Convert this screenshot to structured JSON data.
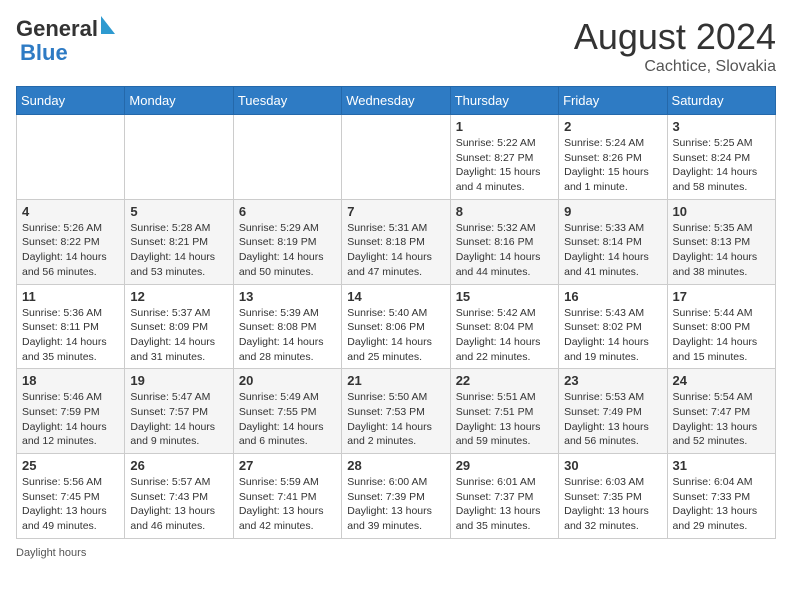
{
  "header": {
    "logo_general": "General",
    "logo_blue": "Blue",
    "month_year": "August 2024",
    "location": "Cachtice, Slovakia"
  },
  "days_of_week": [
    "Sunday",
    "Monday",
    "Tuesday",
    "Wednesday",
    "Thursday",
    "Friday",
    "Saturday"
  ],
  "weeks": [
    [
      {
        "day": "",
        "info": ""
      },
      {
        "day": "",
        "info": ""
      },
      {
        "day": "",
        "info": ""
      },
      {
        "day": "",
        "info": ""
      },
      {
        "day": "1",
        "info": "Sunrise: 5:22 AM\nSunset: 8:27 PM\nDaylight: 15 hours and 4 minutes."
      },
      {
        "day": "2",
        "info": "Sunrise: 5:24 AM\nSunset: 8:26 PM\nDaylight: 15 hours and 1 minute."
      },
      {
        "day": "3",
        "info": "Sunrise: 5:25 AM\nSunset: 8:24 PM\nDaylight: 14 hours and 58 minutes."
      }
    ],
    [
      {
        "day": "4",
        "info": "Sunrise: 5:26 AM\nSunset: 8:22 PM\nDaylight: 14 hours and 56 minutes."
      },
      {
        "day": "5",
        "info": "Sunrise: 5:28 AM\nSunset: 8:21 PM\nDaylight: 14 hours and 53 minutes."
      },
      {
        "day": "6",
        "info": "Sunrise: 5:29 AM\nSunset: 8:19 PM\nDaylight: 14 hours and 50 minutes."
      },
      {
        "day": "7",
        "info": "Sunrise: 5:31 AM\nSunset: 8:18 PM\nDaylight: 14 hours and 47 minutes."
      },
      {
        "day": "8",
        "info": "Sunrise: 5:32 AM\nSunset: 8:16 PM\nDaylight: 14 hours and 44 minutes."
      },
      {
        "day": "9",
        "info": "Sunrise: 5:33 AM\nSunset: 8:14 PM\nDaylight: 14 hours and 41 minutes."
      },
      {
        "day": "10",
        "info": "Sunrise: 5:35 AM\nSunset: 8:13 PM\nDaylight: 14 hours and 38 minutes."
      }
    ],
    [
      {
        "day": "11",
        "info": "Sunrise: 5:36 AM\nSunset: 8:11 PM\nDaylight: 14 hours and 35 minutes."
      },
      {
        "day": "12",
        "info": "Sunrise: 5:37 AM\nSunset: 8:09 PM\nDaylight: 14 hours and 31 minutes."
      },
      {
        "day": "13",
        "info": "Sunrise: 5:39 AM\nSunset: 8:08 PM\nDaylight: 14 hours and 28 minutes."
      },
      {
        "day": "14",
        "info": "Sunrise: 5:40 AM\nSunset: 8:06 PM\nDaylight: 14 hours and 25 minutes."
      },
      {
        "day": "15",
        "info": "Sunrise: 5:42 AM\nSunset: 8:04 PM\nDaylight: 14 hours and 22 minutes."
      },
      {
        "day": "16",
        "info": "Sunrise: 5:43 AM\nSunset: 8:02 PM\nDaylight: 14 hours and 19 minutes."
      },
      {
        "day": "17",
        "info": "Sunrise: 5:44 AM\nSunset: 8:00 PM\nDaylight: 14 hours and 15 minutes."
      }
    ],
    [
      {
        "day": "18",
        "info": "Sunrise: 5:46 AM\nSunset: 7:59 PM\nDaylight: 14 hours and 12 minutes."
      },
      {
        "day": "19",
        "info": "Sunrise: 5:47 AM\nSunset: 7:57 PM\nDaylight: 14 hours and 9 minutes."
      },
      {
        "day": "20",
        "info": "Sunrise: 5:49 AM\nSunset: 7:55 PM\nDaylight: 14 hours and 6 minutes."
      },
      {
        "day": "21",
        "info": "Sunrise: 5:50 AM\nSunset: 7:53 PM\nDaylight: 14 hours and 2 minutes."
      },
      {
        "day": "22",
        "info": "Sunrise: 5:51 AM\nSunset: 7:51 PM\nDaylight: 13 hours and 59 minutes."
      },
      {
        "day": "23",
        "info": "Sunrise: 5:53 AM\nSunset: 7:49 PM\nDaylight: 13 hours and 56 minutes."
      },
      {
        "day": "24",
        "info": "Sunrise: 5:54 AM\nSunset: 7:47 PM\nDaylight: 13 hours and 52 minutes."
      }
    ],
    [
      {
        "day": "25",
        "info": "Sunrise: 5:56 AM\nSunset: 7:45 PM\nDaylight: 13 hours and 49 minutes."
      },
      {
        "day": "26",
        "info": "Sunrise: 5:57 AM\nSunset: 7:43 PM\nDaylight: 13 hours and 46 minutes."
      },
      {
        "day": "27",
        "info": "Sunrise: 5:59 AM\nSunset: 7:41 PM\nDaylight: 13 hours and 42 minutes."
      },
      {
        "day": "28",
        "info": "Sunrise: 6:00 AM\nSunset: 7:39 PM\nDaylight: 13 hours and 39 minutes."
      },
      {
        "day": "29",
        "info": "Sunrise: 6:01 AM\nSunset: 7:37 PM\nDaylight: 13 hours and 35 minutes."
      },
      {
        "day": "30",
        "info": "Sunrise: 6:03 AM\nSunset: 7:35 PM\nDaylight: 13 hours and 32 minutes."
      },
      {
        "day": "31",
        "info": "Sunrise: 6:04 AM\nSunset: 7:33 PM\nDaylight: 13 hours and 29 minutes."
      }
    ]
  ],
  "footer": {
    "daylight_label": "Daylight hours"
  }
}
